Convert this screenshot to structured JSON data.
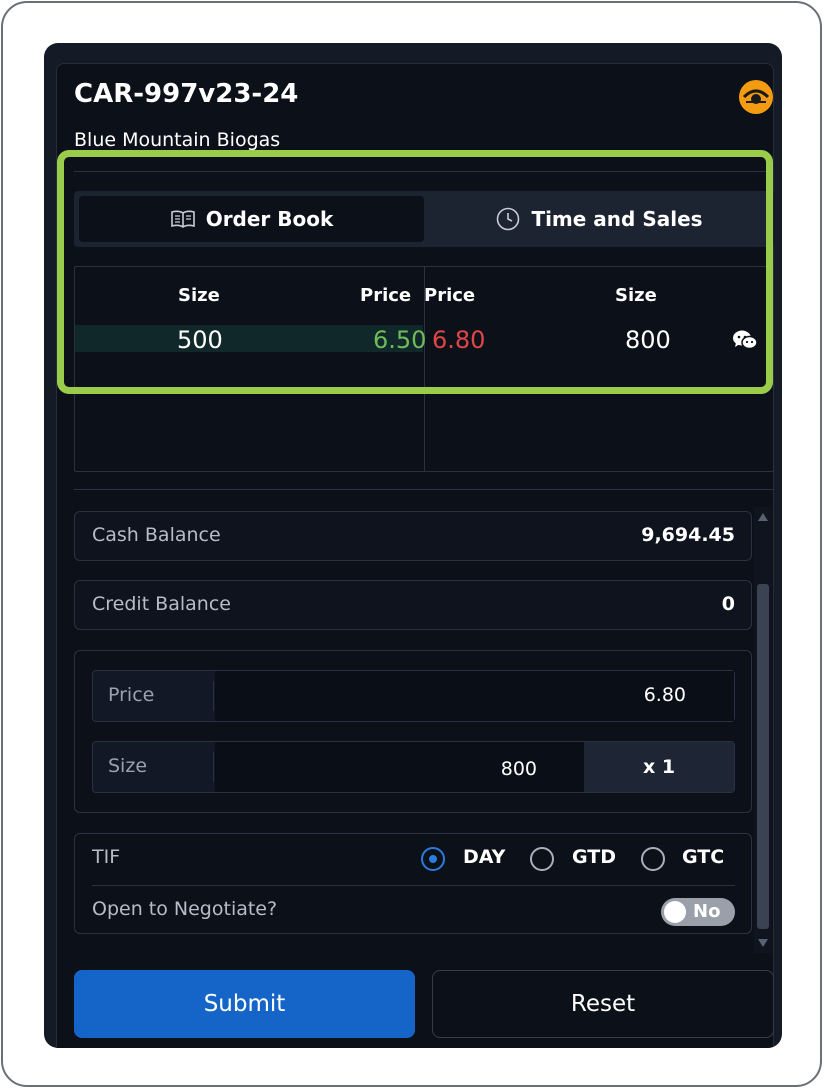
{
  "header": {
    "title": "CAR-997v23-24",
    "subtitle": "Blue Mountain Biogas"
  },
  "tabs": [
    {
      "label": "Order Book",
      "icon": "book-icon",
      "active": true
    },
    {
      "label": "Time and Sales",
      "icon": "clock-icon",
      "active": false
    }
  ],
  "order_book": {
    "headers": {
      "bid_size": "Size",
      "bid_price": "Price",
      "ask_price": "Price",
      "ask_size": "Size"
    },
    "rows": [
      {
        "bid_size": "500",
        "bid_price": "6.50",
        "ask_price": "6.80",
        "ask_size": "800"
      }
    ],
    "chat_icon": "wechat-icon"
  },
  "balances": [
    {
      "label": "Cash Balance",
      "value": "9,694.45"
    },
    {
      "label": "Credit Balance",
      "value": "0"
    }
  ],
  "order_form": {
    "price_label": "Price",
    "price_value": "6.80",
    "size_label": "Size",
    "size_value": "800",
    "multiplier": "x 1"
  },
  "tif": {
    "label": "TIF",
    "options": [
      "DAY",
      "GTD",
      "GTC"
    ],
    "selected": "DAY"
  },
  "negotiate": {
    "label": "Open to Negotiate?",
    "toggle_text": "No"
  },
  "actions": {
    "submit": "Submit",
    "reset": "Reset"
  },
  "colors": {
    "bid_price": "#6dbb5a",
    "ask_price": "#e04646",
    "submit_bg": "#1565c8",
    "highlight": "#9acb4a",
    "brand_logo": "#f39c12"
  }
}
